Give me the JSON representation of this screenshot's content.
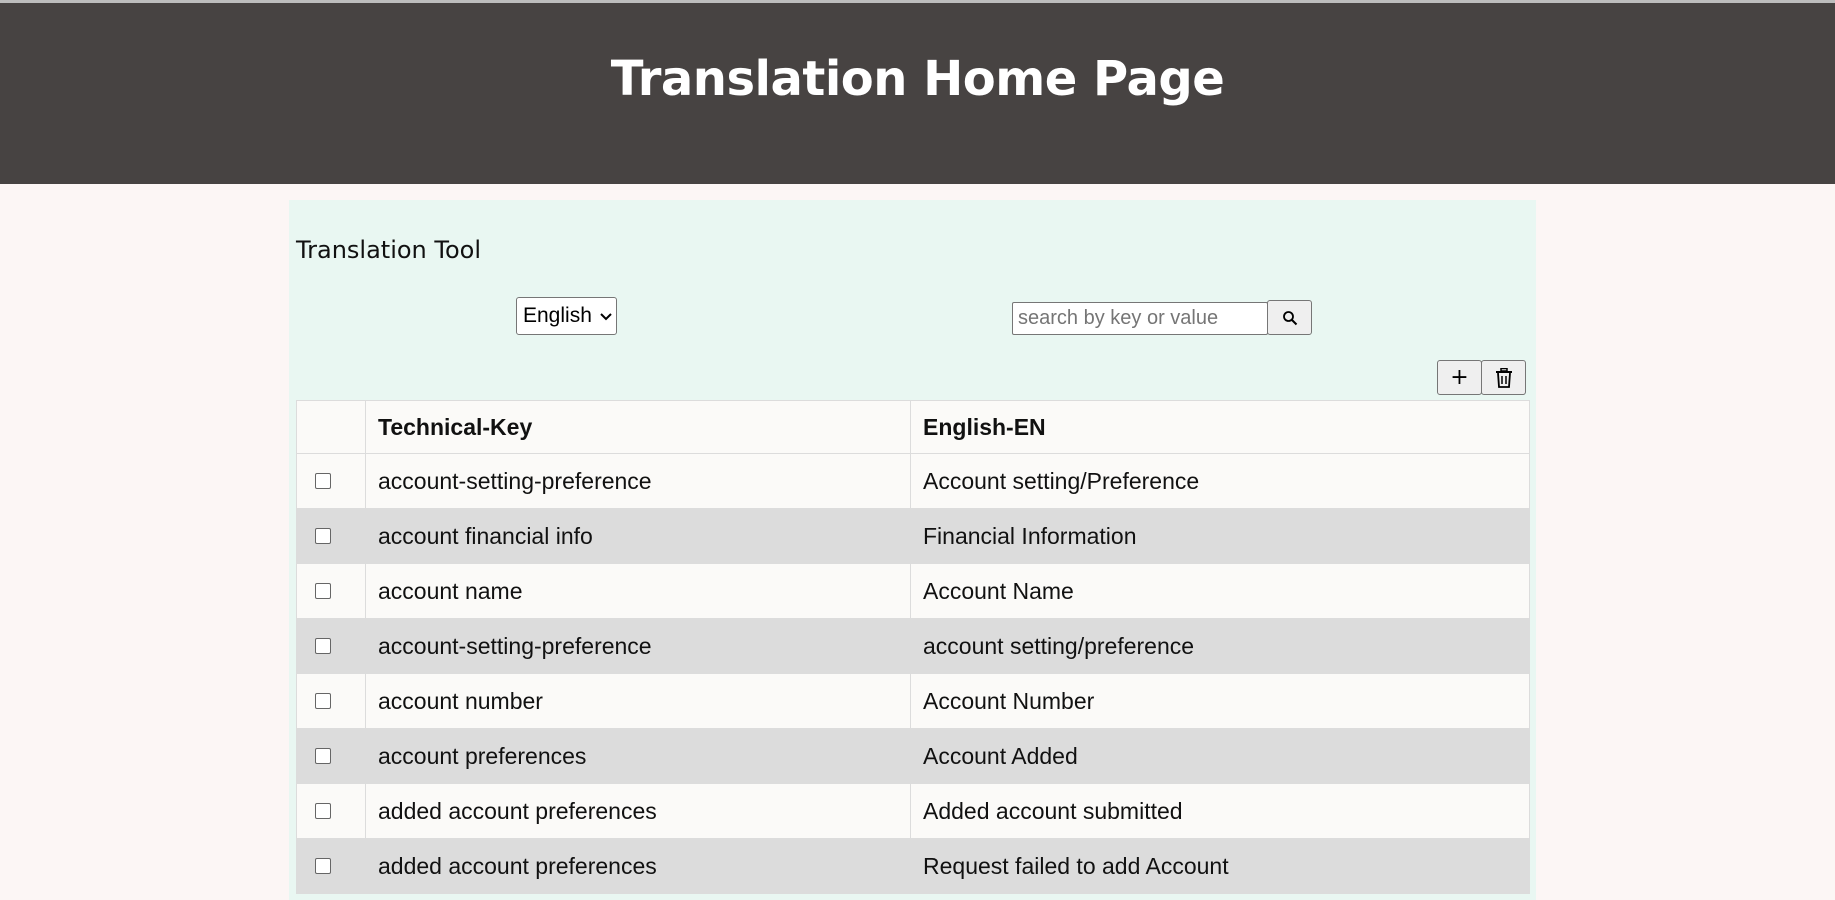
{
  "header": {
    "title": "Translation Home Page"
  },
  "tool": {
    "title": "Translation Tool",
    "language_select": {
      "selected": "English"
    },
    "search": {
      "placeholder": "search by key or value",
      "value": ""
    },
    "buttons": {
      "add_label": "+",
      "search_icon": "search-icon",
      "delete_icon": "trash-icon"
    }
  },
  "table": {
    "headers": [
      "",
      "Technical-Key",
      "English-EN"
    ],
    "rows": [
      {
        "checked": false,
        "key": "account-setting-preference",
        "value": "Account setting/Preference"
      },
      {
        "checked": false,
        "key": "account financial info",
        "value": "Financial Information"
      },
      {
        "checked": false,
        "key": "account name",
        "value": "Account Name"
      },
      {
        "checked": false,
        "key": "account-setting-preference",
        "value": "account setting/preference"
      },
      {
        "checked": false,
        "key": "account number",
        "value": "Account Number"
      },
      {
        "checked": false,
        "key": "account preferences",
        "value": "Account Added"
      },
      {
        "checked": false,
        "key": "added account preferences",
        "value": "Added account submitted"
      },
      {
        "checked": false,
        "key": "added account preferences",
        "value": "Request failed to add Account"
      }
    ]
  },
  "colors": {
    "header_bg": "#474342",
    "page_bg": "#fcf6f5",
    "panel_bg": "#e9f7f2",
    "row_alt_bg": "#dcdcdc"
  }
}
